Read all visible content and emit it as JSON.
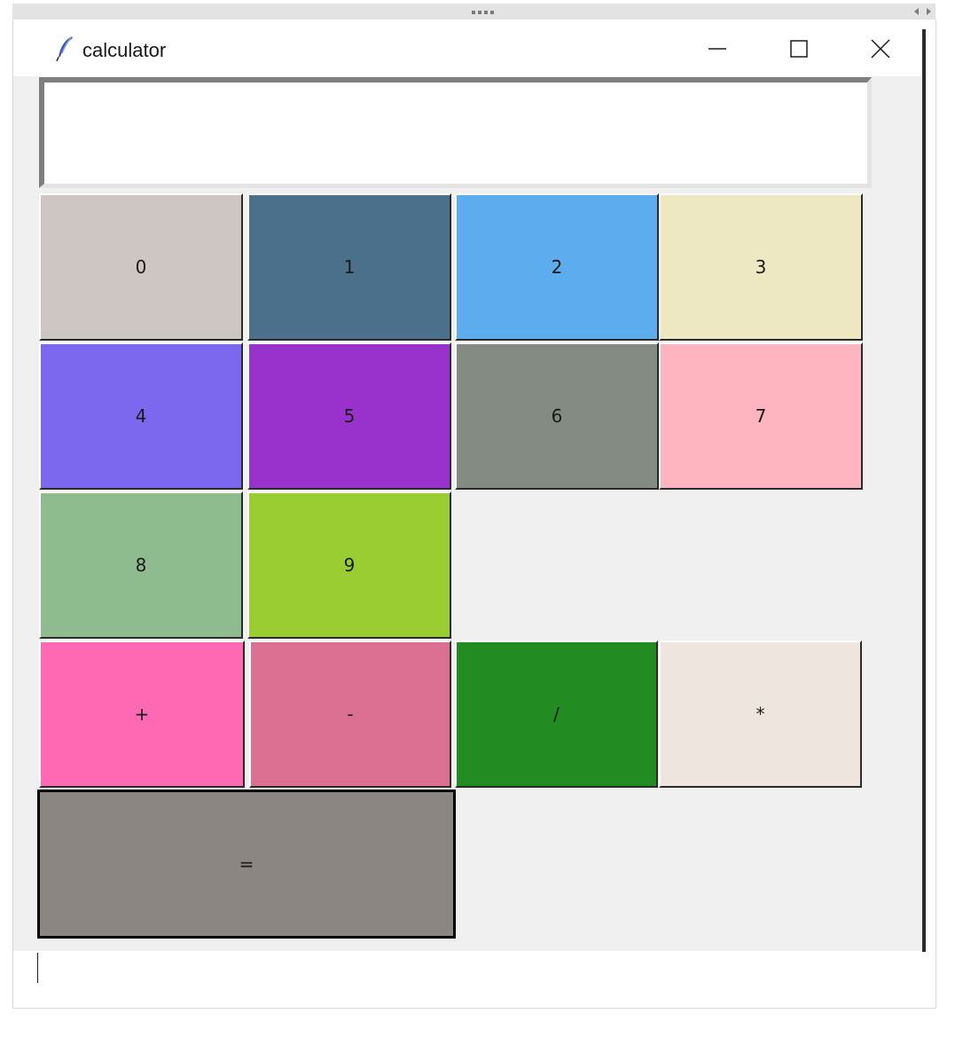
{
  "window": {
    "title": "calculator",
    "app_icon": "feather-icon",
    "controls": {
      "minimize_icon": "minimize-icon",
      "maximize_icon": "maximize-icon",
      "close_icon": "close-icon"
    }
  },
  "display": {
    "value": ""
  },
  "keys": [
    {
      "label": "0",
      "color": "#cdc6c2"
    },
    {
      "label": "1",
      "color": "#4a708b"
    },
    {
      "label": "2",
      "color": "#5cacee"
    },
    {
      "label": "3",
      "color": "#eee8c2"
    },
    {
      "label": "4",
      "color": "#7b68ee"
    },
    {
      "label": "5",
      "color": "#9932cc"
    },
    {
      "label": "6",
      "color": "#838b83"
    },
    {
      "label": "7",
      "color": "#ffb5c0"
    },
    {
      "label": "8",
      "color": "#8fbc8f"
    },
    {
      "label": "9",
      "color": "#9acd32"
    },
    {
      "label": "+",
      "color": "#ff69b4"
    },
    {
      "label": "-",
      "color": "#db7093"
    },
    {
      "label": "/",
      "color": "#228b22"
    },
    {
      "label": "*",
      "color": "#eee5de"
    },
    {
      "label": "=",
      "color": "#8b8682"
    }
  ]
}
